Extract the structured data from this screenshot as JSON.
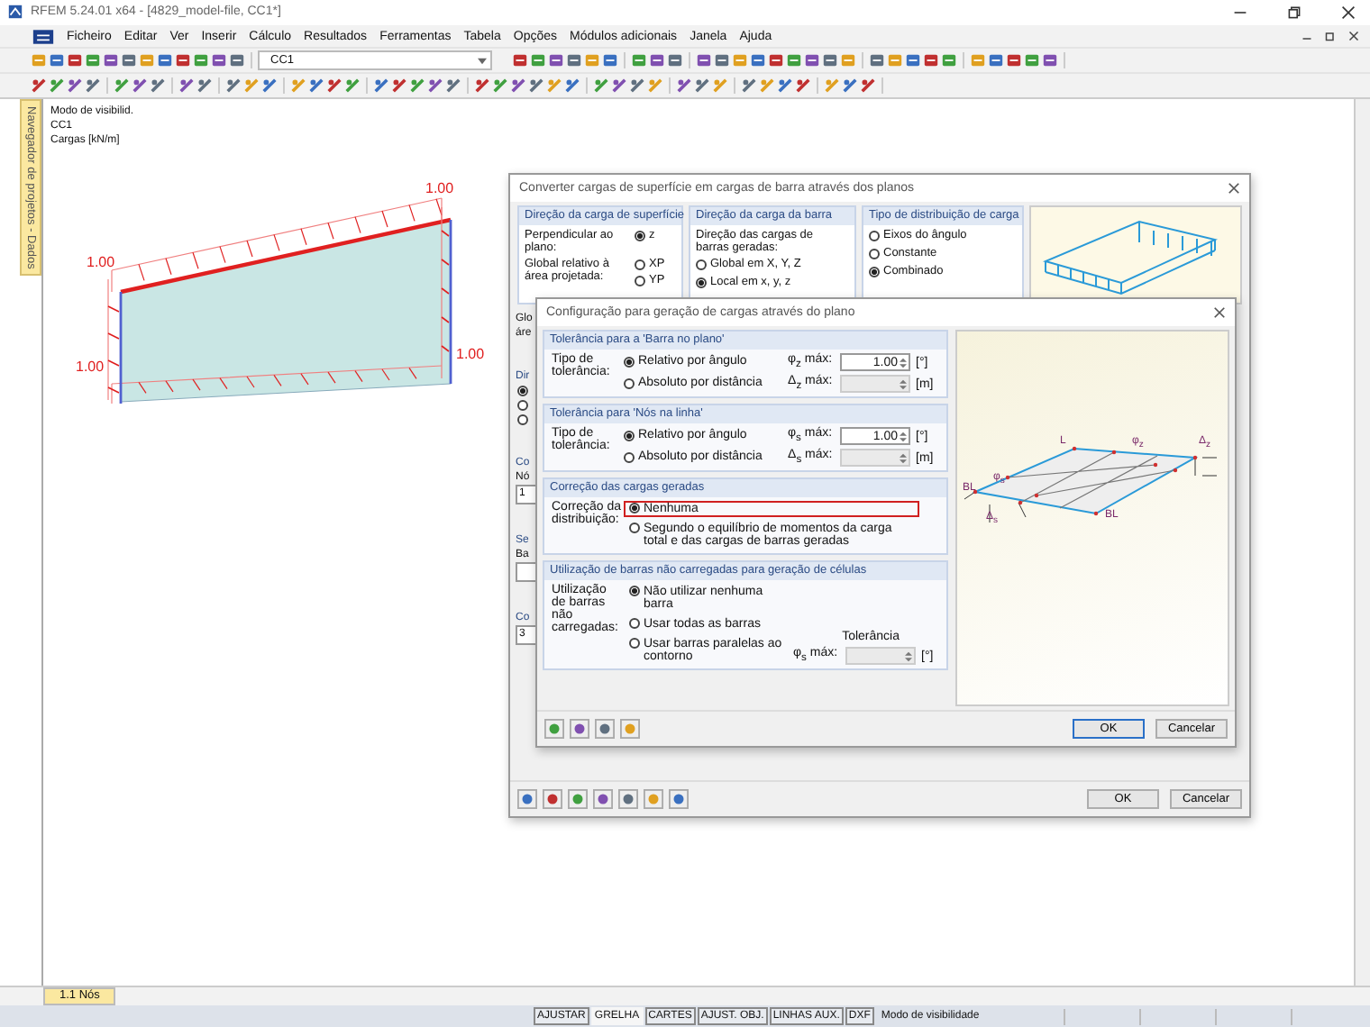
{
  "window": {
    "title": "RFEM 5.24.01 x64 - [4829_model-file, CC1*]"
  },
  "menu": [
    "Ficheiro",
    "Editar",
    "Ver",
    "Inserir",
    "Cálculo",
    "Resultados",
    "Ferramentas",
    "Tabela",
    "Opções",
    "Módulos adicionais",
    "Janela",
    "Ajuda"
  ],
  "toolbar": {
    "load_case": "CC1"
  },
  "navigator_tab": "Navegador de projetos - Dados",
  "viewport": {
    "info": [
      "Modo de visibilid.",
      "CC1",
      "Cargas [kN/m]"
    ],
    "load_labels": [
      "1.00",
      "1.00",
      "1.00",
      "1.00"
    ]
  },
  "bottom_tabs": [
    {
      "label": "1.1 Nós",
      "selected": true
    }
  ],
  "status_bar": {
    "toggles": [
      {
        "label": "AJUSTAR",
        "on": false
      },
      {
        "label": "GRELHA",
        "on": true
      },
      {
        "label": "CARTES",
        "on": false
      },
      {
        "label": "AJUST. OBJ.",
        "on": false
      },
      {
        "label": "LINHAS AUX.",
        "on": false
      },
      {
        "label": "DXF",
        "on": false
      }
    ],
    "mode": "Modo de visibilidade"
  },
  "convert_dialog": {
    "title": "Converter cargas de superfície em cargas de barra através dos planos",
    "groups": [
      {
        "kind": "rows",
        "title": "Direção da carga de superfície",
        "rows": [
          {
            "label": "Perpendicular ao plano:",
            "radios": [
              {
                "label": "z",
                "selected": true
              }
            ]
          },
          {
            "label": "Global relativo à área projetada:",
            "radios": [
              {
                "label": "XP",
                "selected": false
              },
              {
                "label": "YP",
                "selected": false
              }
            ]
          }
        ]
      },
      {
        "kind": "list",
        "title": "Direção da carga da barra",
        "caption": "Direção das cargas de barras geradas:",
        "radios": [
          {
            "label": "Global em X, Y, Z",
            "selected": false
          },
          {
            "label": "Local em x, y, z",
            "selected": true
          }
        ]
      },
      {
        "kind": "list",
        "title": "Tipo de distribuição de carga",
        "radios": [
          {
            "label": "Eixos do ângulo",
            "selected": false
          },
          {
            "label": "Constante",
            "selected": false
          },
          {
            "label": "Combinado",
            "selected": true
          }
        ]
      }
    ],
    "fragments": [
      {
        "kind": "label",
        "text": "Glo"
      },
      {
        "kind": "label",
        "text": "áre"
      },
      {
        "kind": "header",
        "text": "Dir"
      },
      {
        "kind": "radio",
        "selected": true
      },
      {
        "kind": "radio",
        "selected": false
      },
      {
        "kind": "radio",
        "selected": false
      },
      {
        "kind": "header",
        "text": "Co"
      },
      {
        "kind": "label",
        "text": "Nó"
      },
      {
        "kind": "field",
        "text": "1"
      },
      {
        "kind": "header",
        "text": "Se"
      },
      {
        "kind": "label",
        "text": "Ba"
      },
      {
        "kind": "field"
      },
      {
        "kind": "header",
        "text": "Co"
      },
      {
        "kind": "field",
        "text": "3"
      }
    ],
    "buttons": [
      {
        "label": "OK",
        "default": false
      },
      {
        "label": "Cancelar",
        "default": false
      }
    ]
  },
  "config_dialog": {
    "title": "Configuração para geração de cargas através do plano",
    "groups": [
      {
        "kind": "tolerance",
        "title": "Tolerância para a 'Barra no plano'",
        "label": "Tipo de tolerância:",
        "options": [
          {
            "label": "Relativo por ângulo",
            "selected": true,
            "field_label": "φ$_{z}$ máx:",
            "value": "1.00",
            "disabled": false,
            "unit": "[°]"
          },
          {
            "label": "Absoluto por distância",
            "selected": false,
            "field_label": "Δ$_{z}$ máx:",
            "disabled": true,
            "unit": "[m]"
          }
        ]
      },
      {
        "kind": "tolerance",
        "title": "Tolerância para 'Nós na linha'",
        "label": "Tipo de tolerância:",
        "options": [
          {
            "label": "Relativo por ângulo",
            "selected": true,
            "field_label": "φ$_{s}$ máx:",
            "value": "1.00",
            "disabled": false,
            "unit": "[°]"
          },
          {
            "label": "Absoluto por distância",
            "selected": false,
            "field_label": "Δ$_{s}$ máx:",
            "disabled": true,
            "unit": "[m]"
          }
        ]
      },
      {
        "kind": "correction",
        "title": "Correção das cargas geradas",
        "label": "Correção da distribuição:",
        "options": [
          {
            "label": "Nenhuma",
            "selected": true,
            "highlighted": true
          },
          {
            "label": "Segundo o equilíbrio de momentos da carga total e das cargas de barras geradas",
            "selected": false,
            "highlighted": false
          }
        ]
      },
      {
        "kind": "usage",
        "title": "Utilização de barras não carregadas para geração de células",
        "label": "Utilização de barras não carregadas:",
        "options": [
          {
            "label": "Não utilizar nenhuma barra",
            "selected": true
          },
          {
            "label": "Usar todas as barras",
            "selected": false
          },
          {
            "label": "Usar barras paralelas ao contorno",
            "selected": false
          }
        ],
        "tolerance_header": "Tolerância",
        "field_label": "φ$_{s}$ máx:",
        "disabled": true,
        "unit": "[°]"
      }
    ],
    "diagram_labels": [
      "L",
      "φ$_{z}$",
      "Δ$_{z}$",
      "BL",
      "φ$_{s}$",
      "Δ$_{s}$",
      "BL"
    ],
    "buttons": [
      {
        "label": "OK",
        "default": true
      },
      {
        "label": "Cancelar",
        "default": false
      }
    ]
  }
}
